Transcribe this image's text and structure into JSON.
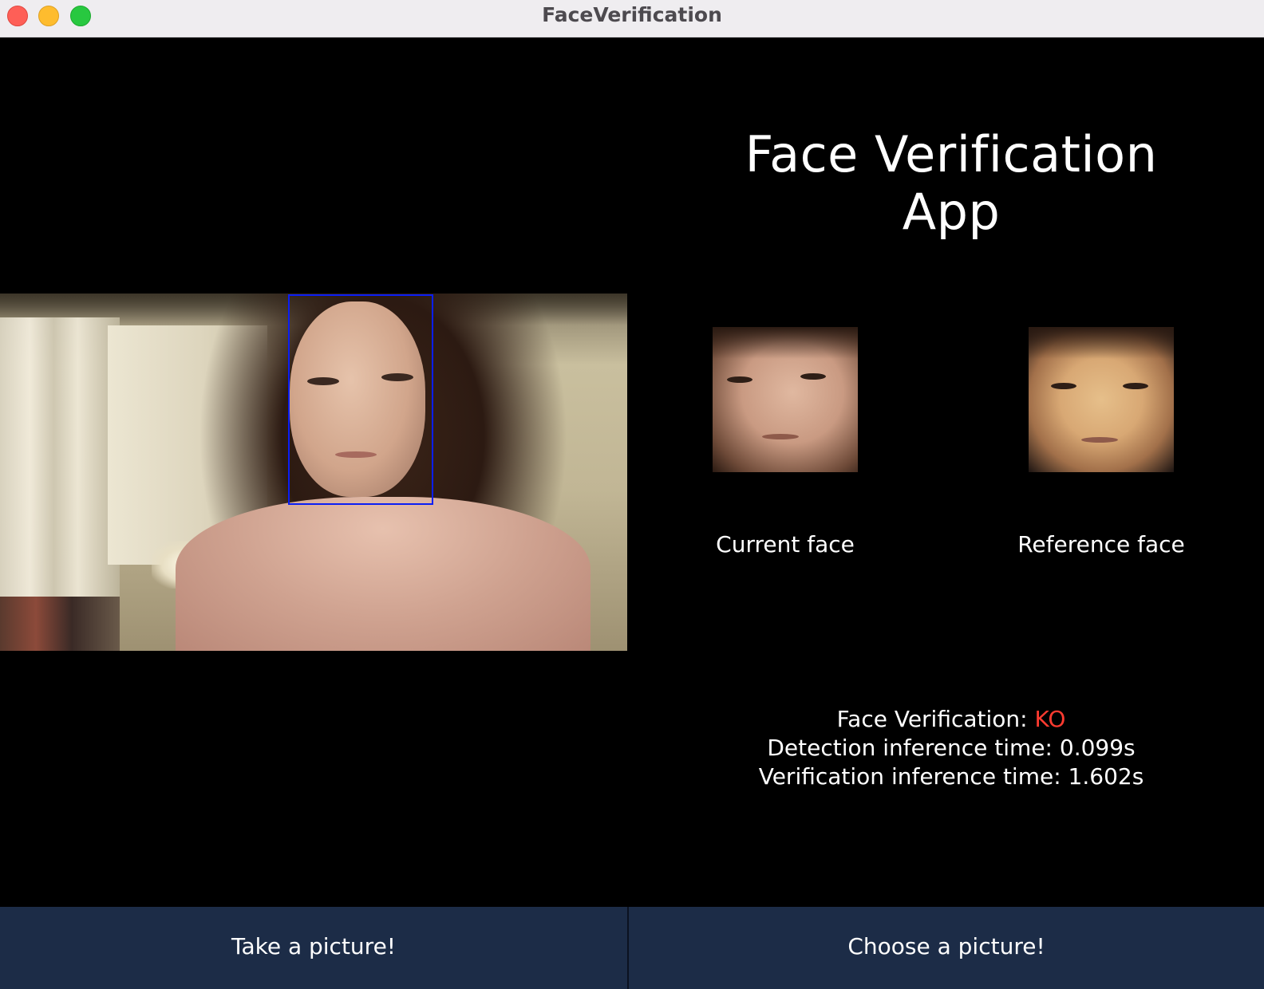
{
  "window": {
    "title": "FaceVerification"
  },
  "header": {
    "title_line1": "Face Verification",
    "title_line2": "App"
  },
  "faces": {
    "current_label": "Current face",
    "reference_label": "Reference face"
  },
  "results": {
    "verification_label": "Face Verification: ",
    "verification_value": "KO",
    "verification_color": "#ff3b30",
    "detection_time": "Detection inference time: 0.099s",
    "verification_time": "Verification inference time: 1.602s"
  },
  "actions": {
    "take_picture": "Take a picture!",
    "choose_picture": "Choose a picture!"
  },
  "colors": {
    "face_box": "#0a1ef5",
    "button_bg": "#1c2c47"
  }
}
